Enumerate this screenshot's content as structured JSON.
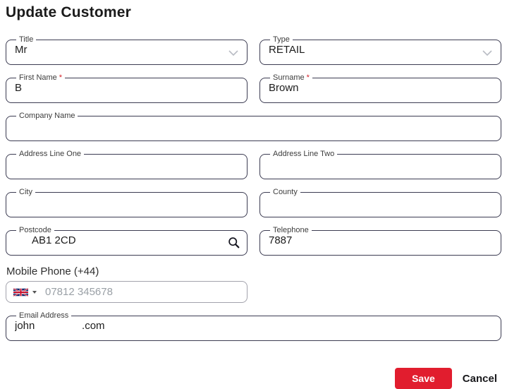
{
  "page": {
    "title": "Update Customer"
  },
  "fields": {
    "title": {
      "label": "Title",
      "value": "Mr"
    },
    "type": {
      "label": "Type",
      "value": "RETAIL"
    },
    "first_name": {
      "label": "First Name",
      "required_mark": "*",
      "value": "B"
    },
    "surname": {
      "label": "Surname",
      "required_mark": "*",
      "value": "Brown"
    },
    "company_name": {
      "label": "Company Name",
      "value": ""
    },
    "address_line_one": {
      "label": "Address Line One",
      "value": ""
    },
    "address_line_two": {
      "label": "Address Line Two",
      "value": ""
    },
    "city": {
      "label": "City",
      "value": ""
    },
    "county": {
      "label": "County",
      "value": ""
    },
    "postcode": {
      "label": "Postcode",
      "value": "AB1 2CD"
    },
    "telephone": {
      "label": "Telephone",
      "value": "7887"
    },
    "mobile_phone": {
      "label": "Mobile Phone (+44)",
      "value": "",
      "placeholder": "07812 345678",
      "country": "UK"
    },
    "email": {
      "label": "Email Address",
      "value": "john                .com"
    }
  },
  "actions": {
    "save_label": "Save",
    "cancel_label": "Cancel"
  },
  "icons": {
    "title_field": "chevron-down-icon",
    "type_field": "chevron-down-icon",
    "postcode_field": "search-icon",
    "mobile_field": "uk-flag-icon",
    "mobile_field_caret": "caret-down-icon"
  },
  "colors": {
    "save_button": "#e11d2e",
    "required_asterisk": "#d3222a",
    "field_border": "#3c3c52",
    "flag_blue": "#012169",
    "flag_red": "#C8102E"
  }
}
